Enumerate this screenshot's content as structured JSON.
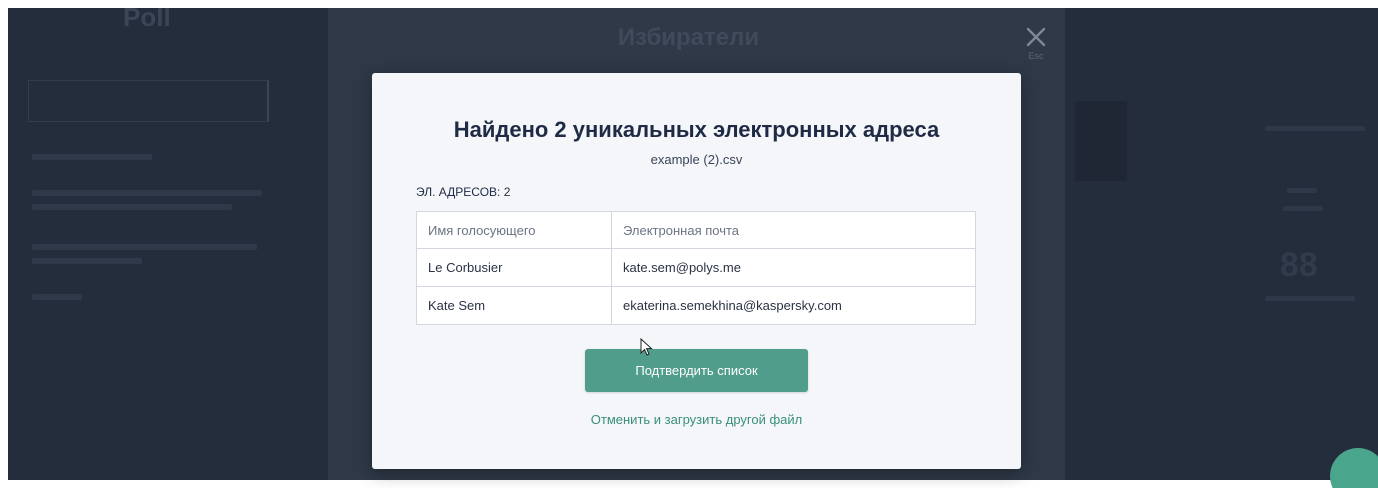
{
  "background": {
    "page_title": "Избиратели",
    "left_logo": "Poll",
    "close_hint": "Esc"
  },
  "modal": {
    "title": "Найдено 2 уникальных электронных адреса",
    "file_name": "example (2).csv",
    "count_label": "ЭЛ. АДРЕСОВ: 2",
    "table": {
      "headers": [
        "Имя голосующего",
        "Электронная почта"
      ],
      "rows": [
        [
          "Le Corbusier",
          "kate.sem@polys.me"
        ],
        [
          "Kate Sem",
          "ekaterina.semekhina@kaspersky.com"
        ]
      ]
    },
    "confirm_label": "Подтвердить список",
    "cancel_label": "Отменить и загрузить другой файл"
  },
  "colors": {
    "accent": "#4f9d8a",
    "link": "#3a8f78",
    "overlay": "#2f3947",
    "modal_bg": "#f4f6fa",
    "title": "#1f2a44"
  },
  "icons": {
    "close": "close-icon",
    "cursor": "mouse-pointer-icon"
  }
}
